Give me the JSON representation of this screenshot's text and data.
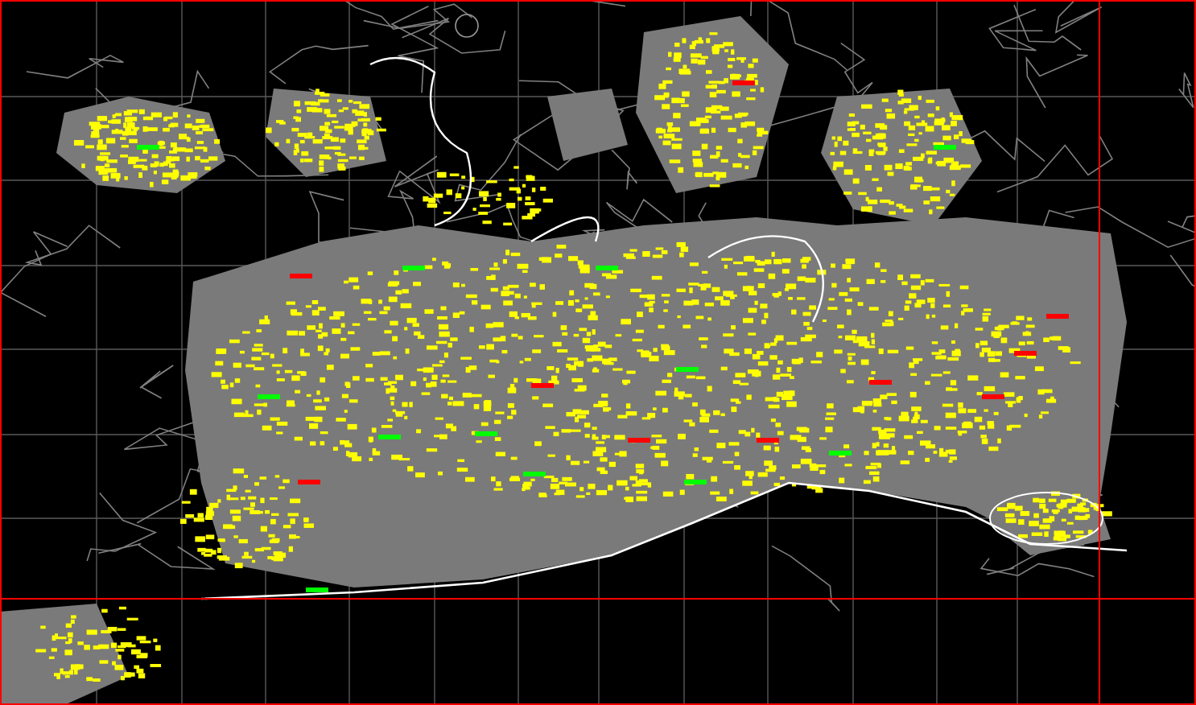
{
  "drawing": {
    "kind": "cad-city-plan"
  }
}
